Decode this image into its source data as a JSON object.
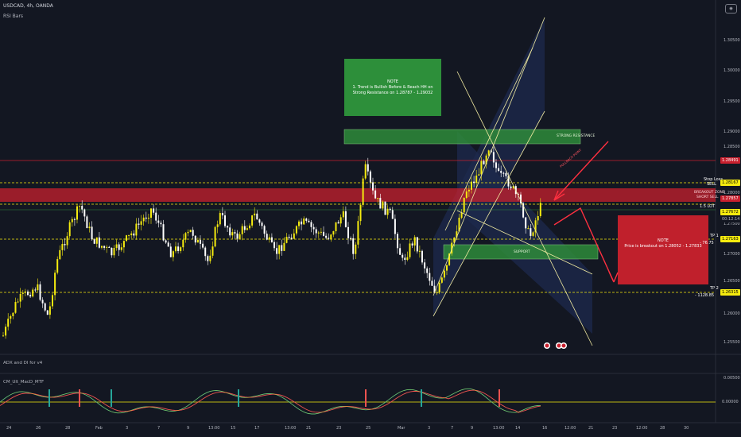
{
  "header": {
    "symbol": "USDCAD, 4h, OANDA",
    "indicator": "RSI Bars",
    "camera_icon": "camera-icon"
  },
  "notes": {
    "note1_title": "NOTE",
    "note1_text": "1. Trend is Bullish Before & Reach HH on Strong Resistance on 1.28787 - 1.29032",
    "note2_title": "NOTE",
    "note2_text": "Price is breakout on 1.28052 - 1.27833"
  },
  "zones": {
    "strong_resistance": "STRONG RESISTANCE",
    "support": "SUPPORT",
    "pullback_label": "PULLBACK POINT"
  },
  "line_labels": {
    "stop_loss": "Stop Loss",
    "sell": "SELL",
    "breakout": "BREAKOUT ZONE",
    "short": "SHORT SELL",
    "lot": "1.5 LOT",
    "tp1": "TP 1",
    "tp1_pips": "- 76.75",
    "tp2": "TP 2",
    "tp2_pips": "- 1128.85"
  },
  "price_axis": {
    "ticks": [
      "1.30500",
      "1.30000",
      "1.29500",
      "1.29000",
      "1.28500",
      "1.28000",
      "1.27500",
      "1.27000",
      "1.26500",
      "1.26000",
      "1.25500"
    ],
    "boxes": [
      "1.28491",
      "1.28167",
      "1.27857",
      "1.27672",
      "00:12:14",
      "1.27163",
      "1.26315"
    ]
  },
  "time_axis": {
    "ticks": [
      "24",
      "26",
      "28",
      "Feb",
      "3",
      "7",
      "9",
      "13:00",
      "15",
      "17",
      "13:00",
      "21",
      "23",
      "25",
      "Mar",
      "3",
      "7",
      "9",
      "13:00",
      "14",
      "16",
      "12:00",
      "21",
      "23",
      "12:00",
      "28",
      "30"
    ]
  },
  "indicators": {
    "adx": "ADX and DI for v4",
    "macd": "CM_Ult_MacD_MTF",
    "macd_ticks": [
      "0.00500",
      "0.00000"
    ]
  },
  "colors": {
    "background": "#131722",
    "bull": "#f5eb0f",
    "bear": "#ffffff",
    "resistance_zone": "#2e8b3a",
    "breakout_zone": "#c8202e",
    "note_red": "#c0202c",
    "note_green": "#2d8f3a",
    "channel": "#1e2a4e"
  }
}
